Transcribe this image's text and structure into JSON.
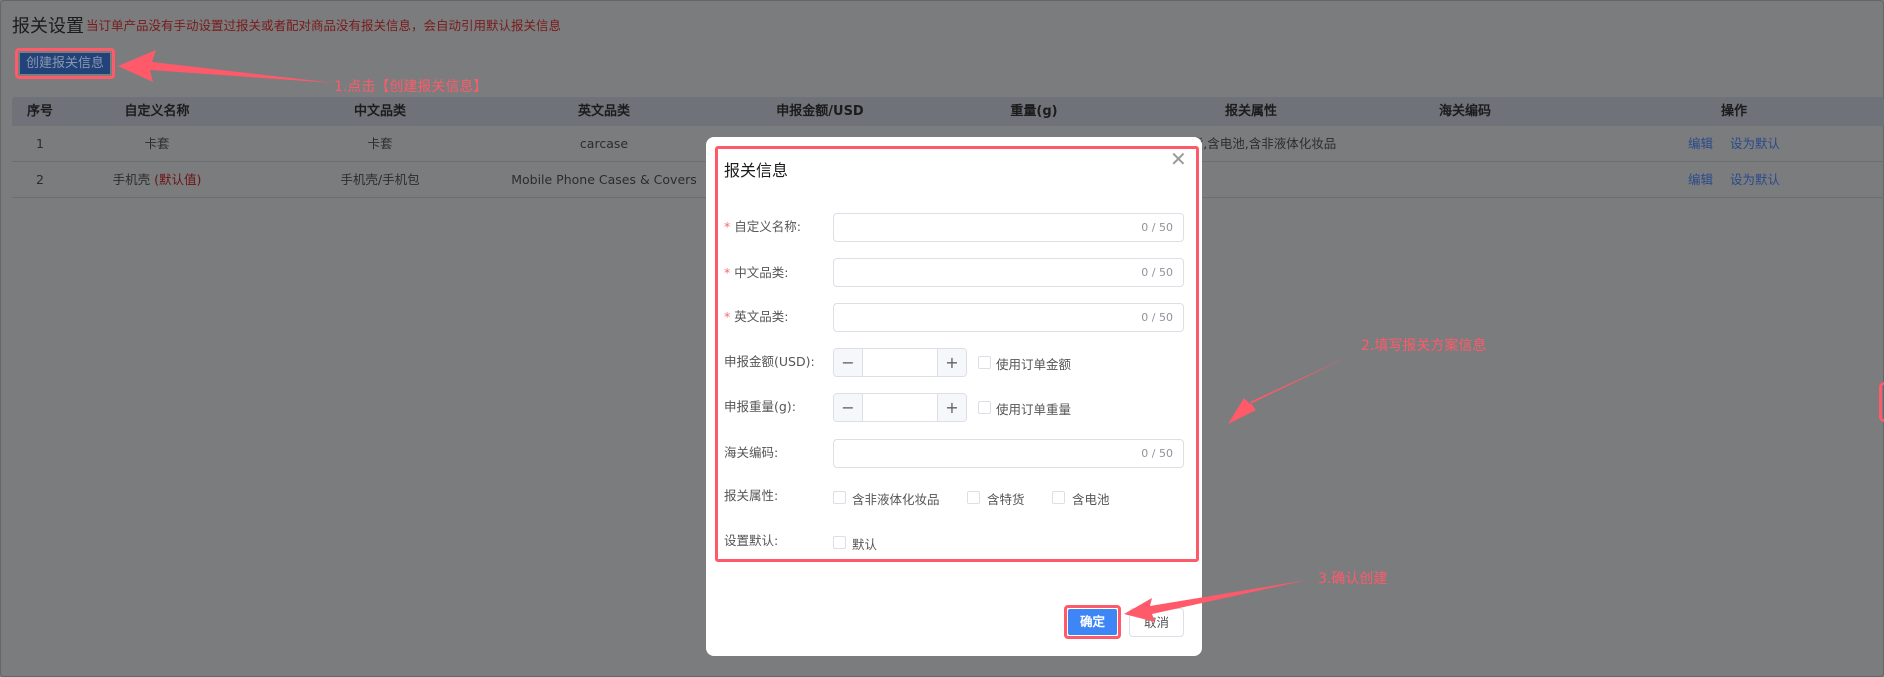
{
  "page": {
    "title": "报关设置",
    "notice": "当订单产品没有手动设置过报关或者配对商品没有报关信息，会自动引用默认报关信息",
    "create_button": "创建报关信息"
  },
  "table": {
    "headers": [
      "序号",
      "自定义名称",
      "中文品类",
      "英文品类",
      "申报金额/USD",
      "重量(g)",
      "报关属性",
      "海关编码",
      "操作"
    ],
    "rows": [
      {
        "index": "1",
        "name": "卡套",
        "default_tag": "",
        "cn": "卡套",
        "en": "carcase",
        "attrs": "含特货,含电池,含非液体化妆品",
        "edit": "编辑",
        "set_default": "设为默认"
      },
      {
        "index": "2",
        "name": "手机壳",
        "default_tag": "(默认值)",
        "cn": "手机壳/手机包",
        "en": "Mobile Phone Cases & Covers",
        "attrs": "",
        "edit": "编辑",
        "set_default": "设为默认"
      }
    ]
  },
  "modal": {
    "title": "报关信息",
    "fields": {
      "custom_name": {
        "label": "自定义名称:",
        "counter": "0 / 50",
        "required": "*"
      },
      "cn_category": {
        "label": "中文品类:",
        "counter": "0 / 50",
        "required": "*"
      },
      "en_category": {
        "label": "英文品类:",
        "counter": "0 / 50",
        "required": "*"
      },
      "amount": {
        "label": "申报金额(USD):",
        "minus": "−",
        "plus": "+",
        "checkbox": "使用订单金额"
      },
      "weight": {
        "label": "申报重量(g):",
        "minus": "−",
        "plus": "+",
        "checkbox": "使用订单重量"
      },
      "hs_code": {
        "label": "海关编码:",
        "counter": "0 / 50"
      },
      "attrs": {
        "label": "报关属性:",
        "options": [
          "含非液体化妆品",
          "含特货",
          "含电池"
        ]
      },
      "default": {
        "label": "设置默认:",
        "option": "默认"
      }
    },
    "ok": "确定",
    "cancel": "取消"
  },
  "annotations": [
    "1.点击【创建报关信息】",
    "2.填写报关方案信息",
    "3.确认创建"
  ],
  "colors": {
    "highlight": "#ff5a6a",
    "primary": "#3e86f5",
    "overlay": "#7b7c7e"
  }
}
